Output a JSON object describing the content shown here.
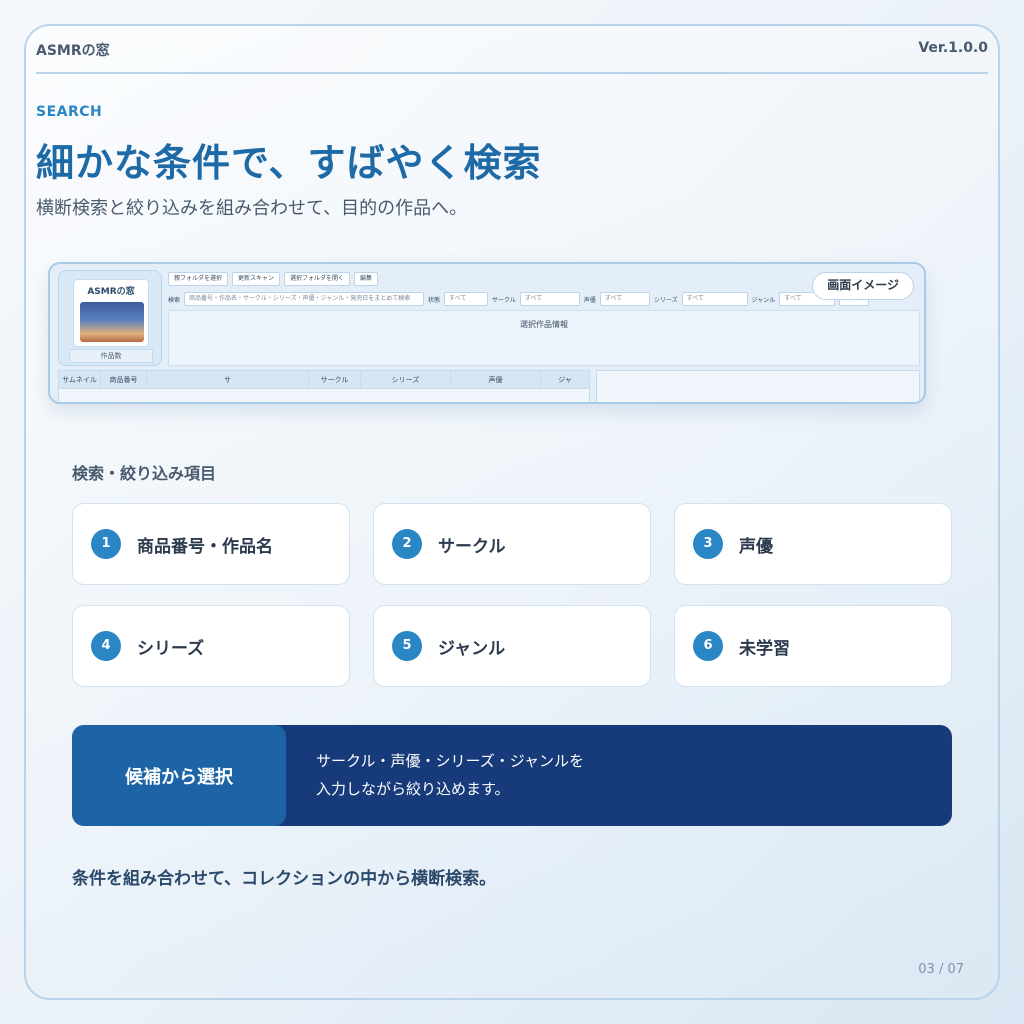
{
  "header": {
    "brand": "ASMRの窓",
    "version": "Ver.1.0.0"
  },
  "hero": {
    "kicker": "SEARCH",
    "title": "細かな条件で、すばやく検索",
    "subtitle": "横断検索と絞り込みを組み合わせて、目的の作品へ。"
  },
  "screenshot": {
    "badge": "画面イメージ",
    "logo": "ASMRの窓",
    "count_label": "作品数",
    "toolbar": [
      "親フォルダを選択",
      "更新スキャン",
      "選択フォルダを開く",
      "編集"
    ],
    "search_label": "検索",
    "search_placeholder": "商品番号・作品名・サークル・シリーズ・声優・ジャンル・発売日をまとめて検索",
    "filters": [
      {
        "label": "状態",
        "value": "すべて"
      },
      {
        "label": "サークル",
        "value": "すべて"
      },
      {
        "label": "声優",
        "value": "すべて"
      },
      {
        "label": "シリーズ",
        "value": "すべて"
      },
      {
        "label": "ジャンル",
        "value": "すべて"
      }
    ],
    "clear": "クリア",
    "info_label": "選択作品情報",
    "columns": [
      "サムネイル",
      "商品番号",
      "サ",
      "サークル",
      "シリーズ",
      "声優",
      "ジャ"
    ]
  },
  "filters_section": {
    "label": "検索・絞り込み項目",
    "items": [
      {
        "num": "1",
        "label": "商品番号・作品名"
      },
      {
        "num": "2",
        "label": "サークル"
      },
      {
        "num": "3",
        "label": "声優"
      },
      {
        "num": "4",
        "label": "シリーズ"
      },
      {
        "num": "5",
        "label": "ジャンル"
      },
      {
        "num": "6",
        "label": "未学習"
      }
    ]
  },
  "banner": {
    "title": "候補から選択",
    "line1": "サークル・声優・シリーズ・ジャンルを",
    "line2": "入力しながら絞り込めます。"
  },
  "footer": {
    "text": "条件を組み合わせて、コレクションの中から横断検索。",
    "page": "03 / 07"
  },
  "colors": {
    "accent": "#2a86c5",
    "title": "#1e6aa6",
    "banner": "#173b7a",
    "banner_left": "#1d64a6"
  }
}
